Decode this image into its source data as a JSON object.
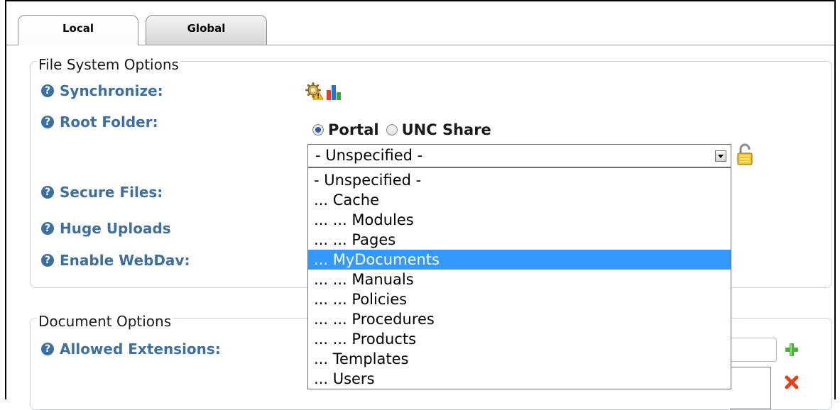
{
  "tabs": [
    {
      "label": "Local",
      "active": true
    },
    {
      "label": "Global",
      "active": false
    }
  ],
  "file_system": {
    "legend": "File System Options",
    "synchronize_label": "Synchronize:",
    "root_folder_label": "Root Folder:",
    "secure_files_label": "Secure Files:",
    "huge_uploads_label": "Huge Uploads",
    "enable_webdav_label": "Enable WebDav:",
    "radio_portal": "Portal",
    "radio_unc": "UNC Share",
    "radio_selected": "Portal",
    "folder_select_value": "- Unspecified -",
    "folder_options": [
      "- Unspecified -",
      "... Cache",
      "... ... Modules",
      "... ... Pages",
      "... MyDocuments",
      "... ... Manuals",
      "... ... Policies",
      "... ... Procedures",
      "... ... Products",
      "... Templates",
      "... Users"
    ],
    "highlighted_option": "... MyDocuments"
  },
  "document_options": {
    "legend": "Document Options",
    "allowed_extensions_label": "Allowed Extensions:"
  },
  "icons": {
    "help": "help-circle-icon",
    "sync_gear": "gear-warning-icon",
    "sync_chart": "bar-chart-icon",
    "lock": "padlock-icon",
    "add": "plus-icon",
    "remove": "x-icon"
  },
  "colors": {
    "label": "#3e6fa0",
    "selection": "#3399ff",
    "fieldset_border": "#c9d3dc"
  }
}
